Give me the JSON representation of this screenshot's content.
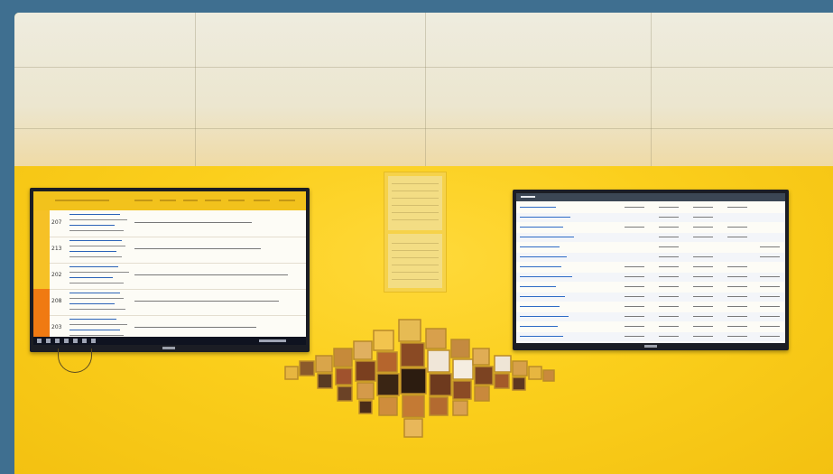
{
  "scene": {
    "wall_color": "#f8cf1e",
    "frame_color": "#3f6f90",
    "ceiling_color": "#eeecdf"
  },
  "left_screen": {
    "header_accent": "#f2c21c",
    "highlight_row_color": "#f07a12",
    "rows": [
      {
        "id": "207",
        "highlighted": false
      },
      {
        "id": "213",
        "highlighted": false
      },
      {
        "id": "202",
        "highlighted": false
      },
      {
        "id": "208",
        "highlighted": true
      },
      {
        "id": "203",
        "highlighted": true
      }
    ]
  },
  "right_screen": {
    "titlebar_color": "#3b4654",
    "link_color": "#2e6bc6"
  }
}
